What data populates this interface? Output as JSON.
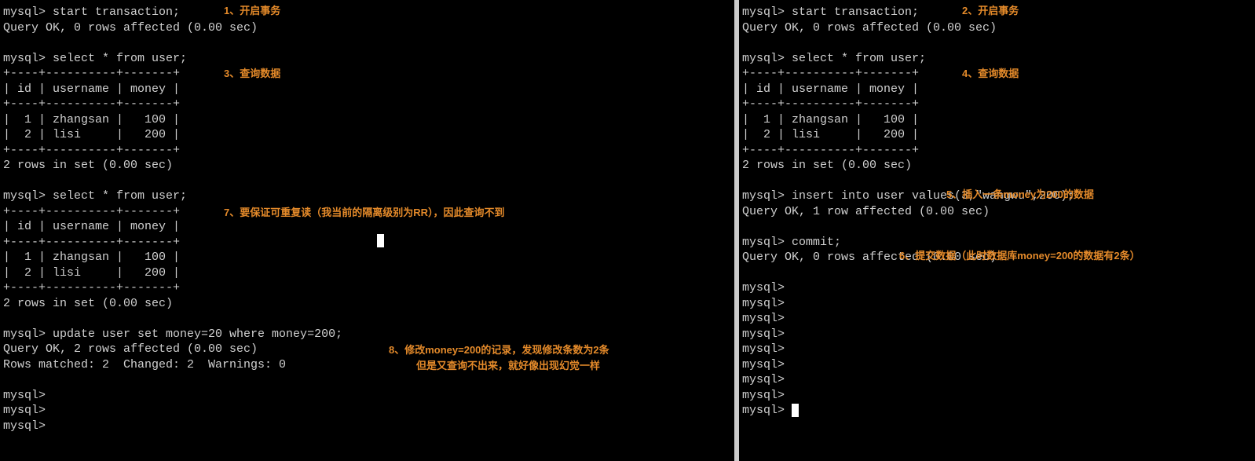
{
  "left": {
    "l1": "mysql> start transaction;",
    "l2": "Query OK, 0 rows affected (0.00 sec)",
    "l3": "",
    "l4": "mysql> select * from user;",
    "l5": "+----+----------+-------+",
    "l6": "| id | username | money |",
    "l7": "+----+----------+-------+",
    "l8": "|  1 | zhangsan |   100 |",
    "l9": "|  2 | lisi     |   200 |",
    "l10": "+----+----------+-------+",
    "l11": "2 rows in set (0.00 sec)",
    "l12": "",
    "l13": "mysql> select * from user;",
    "l14": "+----+----------+-------+",
    "l15": "| id | username | money |",
    "l16": "+----+----------+-------+",
    "l17": "|  1 | zhangsan |   100 |",
    "l18": "|  2 | lisi     |   200 |",
    "l19": "+----+----------+-------+",
    "l20": "2 rows in set (0.00 sec)",
    "l21": "",
    "l22": "mysql> update user set money=20 where money=200;",
    "l23": "Query OK, 2 rows affected (0.00 sec)",
    "l24": "Rows matched: 2  Changed: 2  Warnings: 0",
    "l25": "",
    "l26": "mysql>",
    "l27": "mysql>",
    "l28": "mysql>"
  },
  "right": {
    "r1": "mysql> start transaction;",
    "r2": "Query OK, 0 rows affected (0.00 sec)",
    "r3": "",
    "r4": "mysql> select * from user;",
    "r5": "+----+----------+-------+",
    "r6": "| id | username | money |",
    "r7": "+----+----------+-------+",
    "r8": "|  1 | zhangsan |   100 |",
    "r9": "|  2 | lisi     |   200 |",
    "r10": "+----+----------+-------+",
    "r11": "2 rows in set (0.00 sec)",
    "r12": "",
    "r13": "mysql> insert into user values(3,\"wangwu\",200);",
    "r14": "Query OK, 1 row affected (0.00 sec)",
    "r15": "",
    "r16": "mysql> commit;",
    "r17": "Query OK, 0 rows affected (0.00 sec)",
    "r18": "",
    "r19": "mysql>",
    "r20": "mysql>",
    "r21": "mysql>",
    "r22": "mysql>",
    "r23": "mysql>",
    "r24": "mysql>",
    "r25": "mysql>",
    "r26": "mysql>",
    "r27": "mysql> "
  },
  "annotations": {
    "a1": "1、开启事务",
    "a2": "2、开启事务",
    "a3": "3、查询数据",
    "a4": "4、查询数据",
    "a5": "5、插入一条money为200的数据",
    "a6": "6、提交数据（此时数据库money=200的数据有2条）",
    "a7": "7、要保证可重复读（我当前的隔离级别为RR），因此查询不到",
    "a8a": "8、修改money=200的记录，发现修改条数为2条",
    "a8b": "但是又查询不出来，就好像出现幻觉一样"
  }
}
